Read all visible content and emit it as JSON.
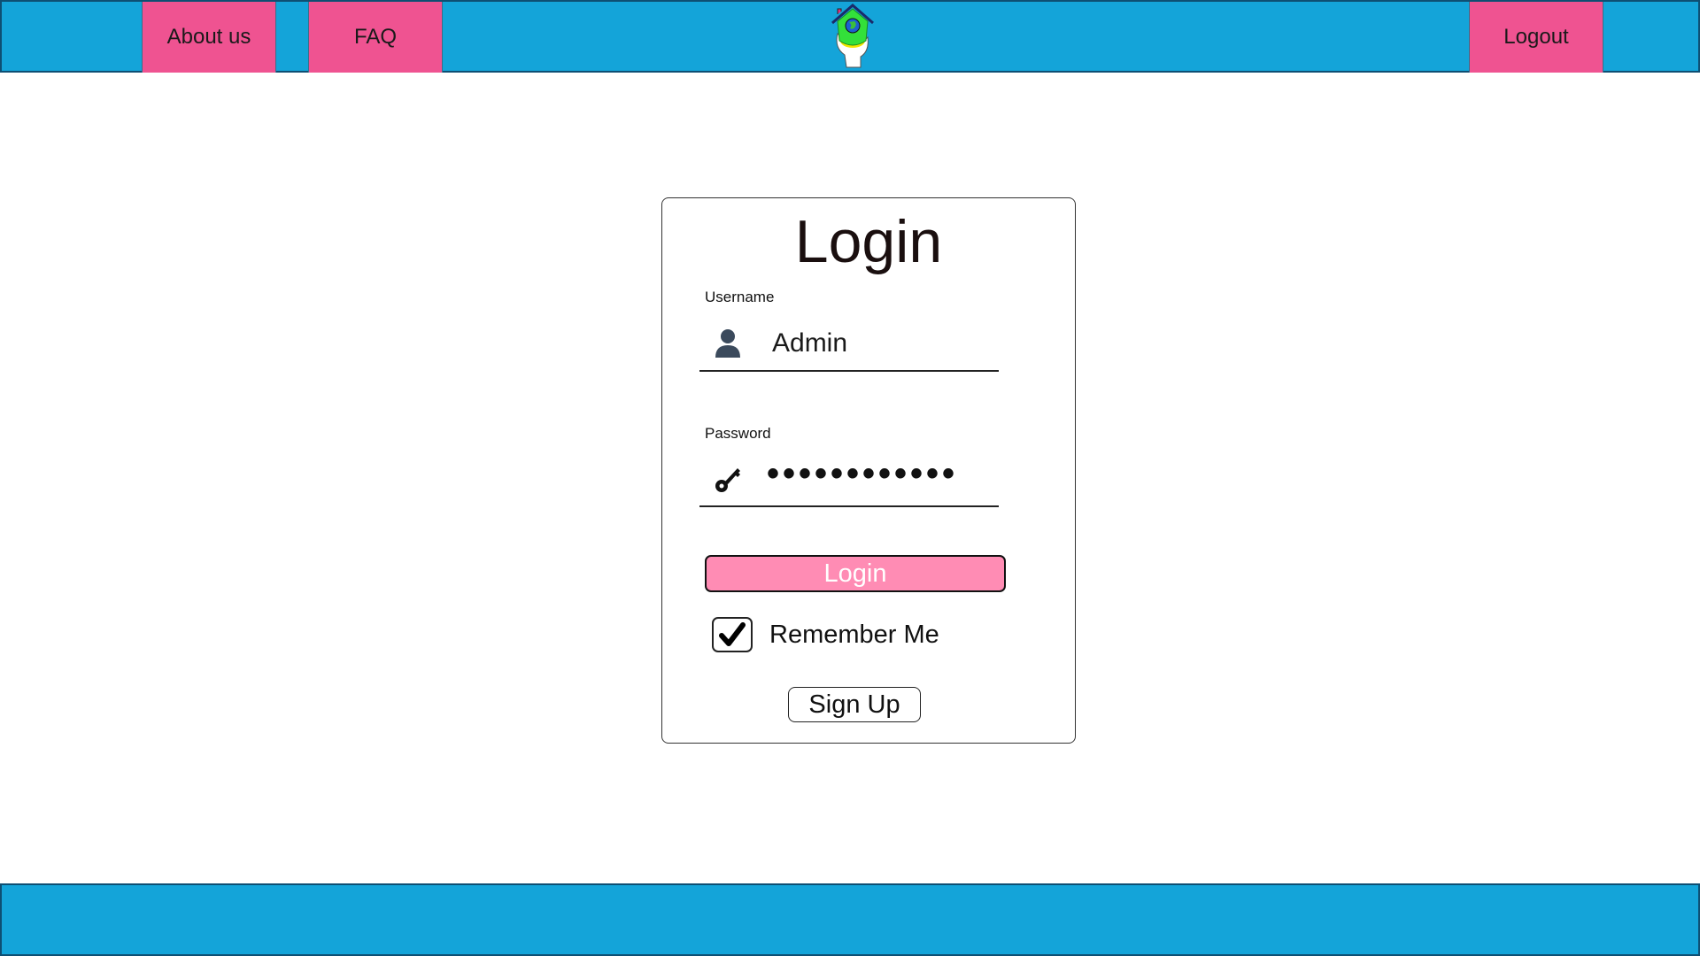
{
  "header": {
    "nav": {
      "about_label": "About us",
      "faq_label": "FAQ",
      "logout_label": "Logout"
    },
    "logo_icon": "house-globe-hand-logo"
  },
  "login": {
    "title": "Login",
    "username": {
      "label": "Username",
      "value": "Admin",
      "icon": "user-icon"
    },
    "password": {
      "label": "Password",
      "masked_value": "••••••••••••",
      "icon": "key-icon"
    },
    "submit_label": "Login",
    "remember": {
      "label": "Remember Me",
      "checked": true
    },
    "signup_label": "Sign Up"
  },
  "colors": {
    "header_bg": "#14a4d9",
    "nav_button": "#ef5391",
    "login_button": "#ff8cb4"
  }
}
